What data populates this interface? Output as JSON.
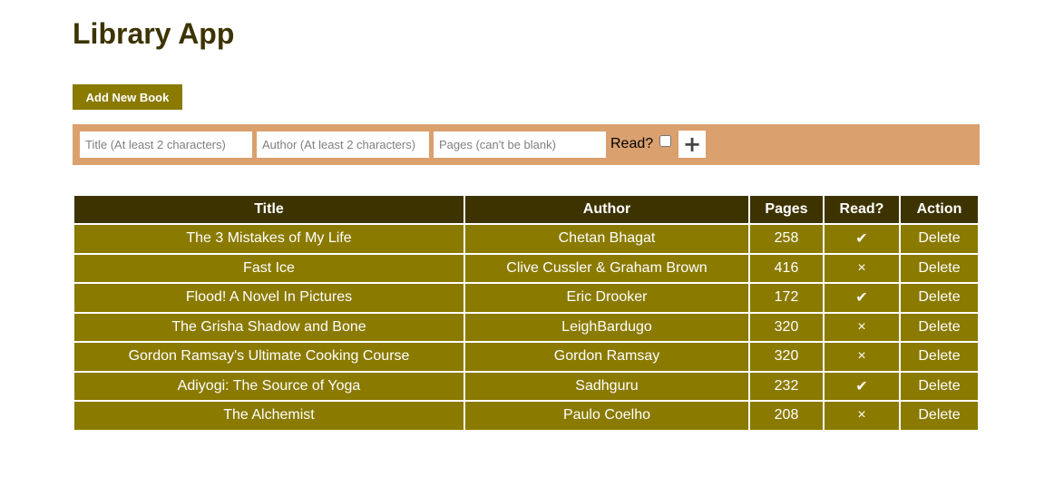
{
  "app": {
    "title": "Library App",
    "add_new_label": "Add New Book"
  },
  "form": {
    "title_placeholder": "Title (At least 2 characters)",
    "author_placeholder": "Author (At least 2 characters)",
    "pages_placeholder": "Pages (can't be blank)",
    "read_label": "Read?",
    "read_checked": false,
    "add_symbol": "+"
  },
  "table": {
    "headers": {
      "title": "Title",
      "author": "Author",
      "pages": "Pages",
      "read": "Read?",
      "action": "Action"
    },
    "rows": [
      {
        "title": "The 3 Mistakes of My Life",
        "author": "Chetan Bhagat",
        "pages": "258",
        "read": "✔",
        "action": "Delete"
      },
      {
        "title": "Fast Ice",
        "author": "Clive Cussler & Graham Brown",
        "pages": "416",
        "read": "×",
        "action": "Delete"
      },
      {
        "title": "Flood! A Novel In Pictures",
        "author": "Eric Drooker",
        "pages": "172",
        "read": "✔",
        "action": "Delete"
      },
      {
        "title": "The Grisha Shadow and Bone",
        "author": "LeighBardugo",
        "pages": "320",
        "read": "×",
        "action": "Delete"
      },
      {
        "title": "Gordon Ramsay's Ultimate Cooking Course",
        "author": "Gordon Ramsay",
        "pages": "320",
        "read": "×",
        "action": "Delete"
      },
      {
        "title": "Adiyogi: The Source of Yoga",
        "author": "Sadhguru",
        "pages": "232",
        "read": "✔",
        "action": "Delete"
      },
      {
        "title": "The Alchemist",
        "author": "Paulo Coelho",
        "pages": "208",
        "read": "×",
        "action": "Delete"
      }
    ]
  },
  "colors": {
    "heading": "#3d3300",
    "accent": "#8a7a00",
    "form_background": "#daa06e"
  }
}
